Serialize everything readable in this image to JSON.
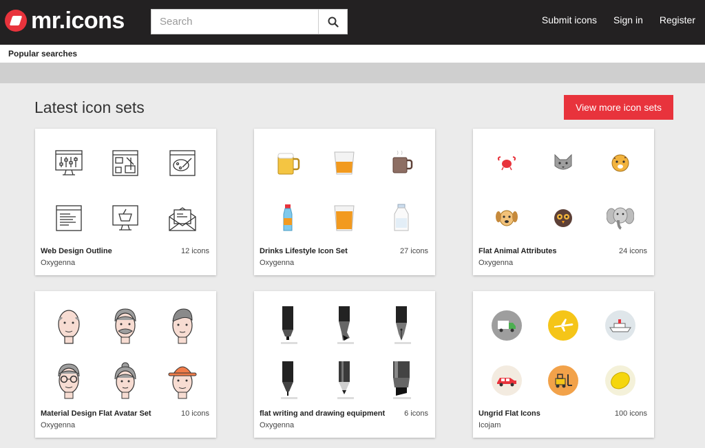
{
  "header": {
    "logo_text": "mr.icons",
    "search_placeholder": "Search",
    "nav": [
      "Submit icons",
      "Sign in",
      "Register"
    ]
  },
  "popular": {
    "label": "Popular searches"
  },
  "main": {
    "title": "Latest icon sets",
    "more_button": "View more icon sets"
  },
  "cards": [
    {
      "title": "Web Design Outline",
      "count": "12 icons",
      "author": "Oxygenna",
      "icons": [
        "monitor-sliders-icon",
        "browser-wireframe-icon",
        "browser-paint-icon",
        "browser-text-icon",
        "monitor-basket-icon",
        "email-envelope-icon"
      ]
    },
    {
      "title": "Drinks Lifestyle Icon Set",
      "count": "27 icons",
      "author": "Oxygenna",
      "icons": [
        "beer-mug-icon",
        "whisky-glass-icon",
        "coffee-mug-icon",
        "soda-bottle-icon",
        "juice-glass-icon",
        "milk-bottle-icon"
      ]
    },
    {
      "title": "Flat Animal Attributes",
      "count": "24 icons",
      "author": "Oxygenna",
      "icons": [
        "crab-icon",
        "cat-icon",
        "cheetah-icon",
        "dog-icon",
        "owl-icon",
        "elephant-icon"
      ]
    },
    {
      "title": "Material Design Flat Avatar Set",
      "count": "10 icons",
      "author": "Oxygenna",
      "icons": [
        "bald-man-avatar-icon",
        "mustache-man-avatar-icon",
        "young-man-avatar-icon",
        "glasses-man-avatar-icon",
        "old-woman-avatar-icon",
        "hat-man-avatar-icon"
      ]
    },
    {
      "title": "flat writing and drawing equipment",
      "count": "6 icons",
      "author": "Oxygenna",
      "icons": [
        "marker-icon",
        "brush-pen-icon",
        "fountain-pen-icon",
        "fineliner-icon",
        "pencil-icon",
        "highlighter-icon"
      ]
    },
    {
      "title": "Ungrid Flat Icons",
      "count": "100 icons",
      "author": "Icojam",
      "icons": [
        "truck-icon",
        "airplane-icon",
        "ship-icon",
        "car-icon",
        "forklift-icon",
        "lemon-icon"
      ]
    }
  ],
  "colors": {
    "header_bg": "#232122",
    "accent": "#e8333c",
    "page_bg": "#ebebeb"
  }
}
